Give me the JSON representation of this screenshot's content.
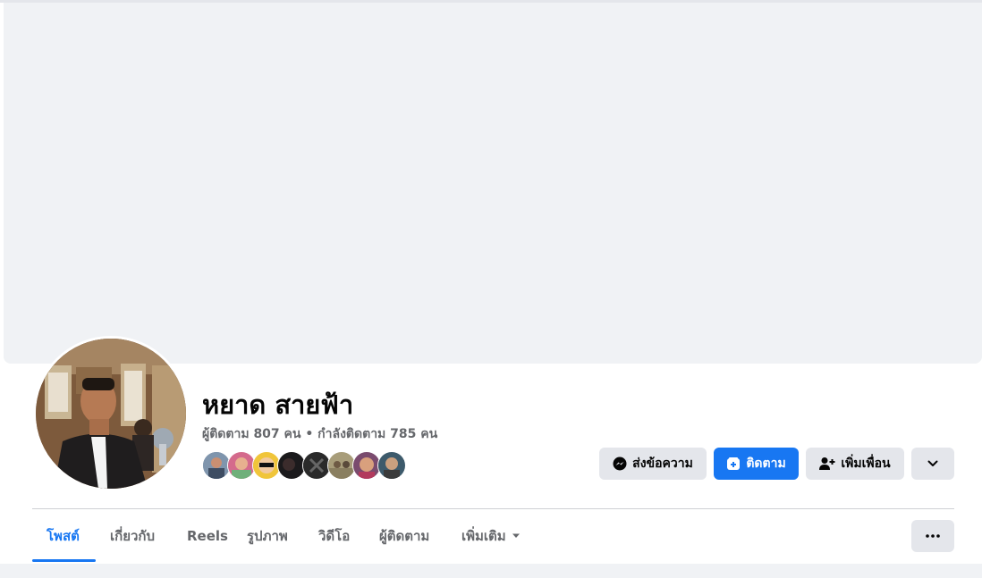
{
  "profile": {
    "name": "หยาด สายฟ้า",
    "stats": "ผู้ติดตาม 807 คน • กำลังติดตาม 785 คน"
  },
  "actions": {
    "message_label": "ส่งข้อความ",
    "follow_label": "ติดตาม",
    "add_friend_label": "เพิ่มเพื่อน"
  },
  "tabs": [
    {
      "label": "โพสต์",
      "active": true
    },
    {
      "label": "เกี่ยวกับ",
      "active": false
    },
    {
      "label": "Reels",
      "active": false
    },
    {
      "label": "รูปภาพ",
      "active": false
    },
    {
      "label": "วิดีโอ",
      "active": false
    },
    {
      "label": "ผู้ติดตาม",
      "active": false
    },
    {
      "label": "เพิ่มเติม",
      "active": false
    }
  ],
  "colors": {
    "accent": "#1877f2",
    "cover": "#f0f2f5",
    "button_grey": "#e4e6eb",
    "secondary_text": "#65676b"
  },
  "icons": {
    "message": "messenger-icon",
    "follow": "follow-icon",
    "add_friend": "add-friend-icon",
    "dropdown": "chevron-down-icon",
    "more_tab": "caret-down-icon",
    "options": "more-options-icon"
  }
}
